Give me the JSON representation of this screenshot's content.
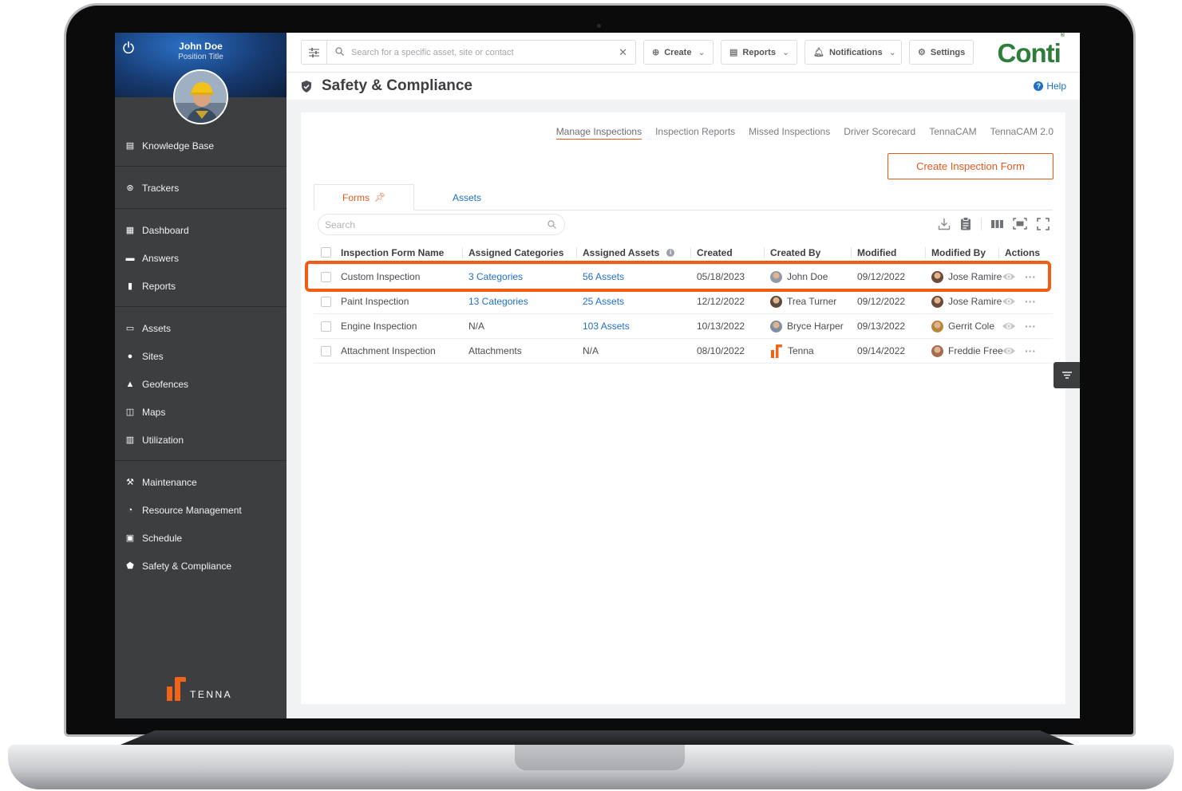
{
  "profile": {
    "name": "John Doe",
    "title": "Position Title"
  },
  "sidebar": {
    "groups": [
      [
        {
          "label": "Knowledge Base",
          "icon": "book-icon"
        }
      ],
      [
        {
          "label": "Trackers",
          "icon": "tracker-icon"
        }
      ],
      [
        {
          "label": "Dashboard",
          "icon": "dashboard-icon"
        },
        {
          "label": "Answers",
          "icon": "chat-icon"
        },
        {
          "label": "Reports",
          "icon": "document-icon"
        }
      ],
      [
        {
          "label": "Assets",
          "icon": "asset-icon"
        },
        {
          "label": "Sites",
          "icon": "pin-icon"
        },
        {
          "label": "Geofences",
          "icon": "geofence-icon"
        },
        {
          "label": "Maps",
          "icon": "map-icon"
        },
        {
          "label": "Utilization",
          "icon": "chart-icon"
        }
      ],
      [
        {
          "label": "Maintenance",
          "icon": "wrench-icon"
        },
        {
          "label": "Resource Management",
          "icon": "pie-icon"
        },
        {
          "label": "Schedule",
          "icon": "calendar-icon"
        },
        {
          "label": "Safety & Compliance",
          "icon": "shield-icon"
        }
      ]
    ],
    "brand": "TENNA"
  },
  "topbar": {
    "search_placeholder": "Search for a specific asset, site or contact",
    "create_label": "Create",
    "reports_label": "Reports",
    "notifications_label": "Notifications",
    "settings_label": "Settings",
    "brand_logo": "Conti"
  },
  "page": {
    "title": "Safety & Compliance",
    "help_label": "Help"
  },
  "subnav": [
    "Manage Inspections",
    "Inspection Reports",
    "Missed Inspections",
    "Driver Scorecard",
    "TennaCAM",
    "TennaCAM 2.0"
  ],
  "create_inspection_label": "Create Inspection Form",
  "tabs": {
    "forms": "Forms",
    "assets": "Assets"
  },
  "table_search_placeholder": "Search",
  "table": {
    "columns": [
      "Inspection Form Name",
      "Assigned Categories",
      "Assigned Assets",
      "Created",
      "Created By",
      "Modified",
      "Modified By",
      "Actions"
    ],
    "rows": [
      {
        "name": "Custom Inspection",
        "categories": "3 Categories",
        "assets": "56 Assets",
        "created": "05/18/2023",
        "created_by": "John Doe",
        "modified": "09/12/2022",
        "modified_by": "Jose Ramire"
      },
      {
        "name": "Paint Inspection",
        "categories": "13 Categories",
        "assets": "25 Assets",
        "created": "12/12/2022",
        "created_by": "Trea Turner",
        "modified": "09/12/2022",
        "modified_by": "Jose Ramire"
      },
      {
        "name": "Engine Inspection",
        "categories": "N/A",
        "assets": "103 Assets",
        "created": "10/13/2022",
        "created_by": "Bryce Harper",
        "modified": "09/13/2022",
        "modified_by": "Gerrit Cole"
      },
      {
        "name": "Attachment Inspection",
        "categories": "Attachments",
        "assets": "N/A",
        "created": "08/10/2022",
        "created_by": "Tenna",
        "modified": "09/14/2022",
        "modified_by": "Freddie Free"
      }
    ]
  },
  "colors": {
    "accent": "#e25a1c",
    "link": "#1f6fc9",
    "sidebar": "#3d3e40",
    "highlight": "#f25c14"
  }
}
